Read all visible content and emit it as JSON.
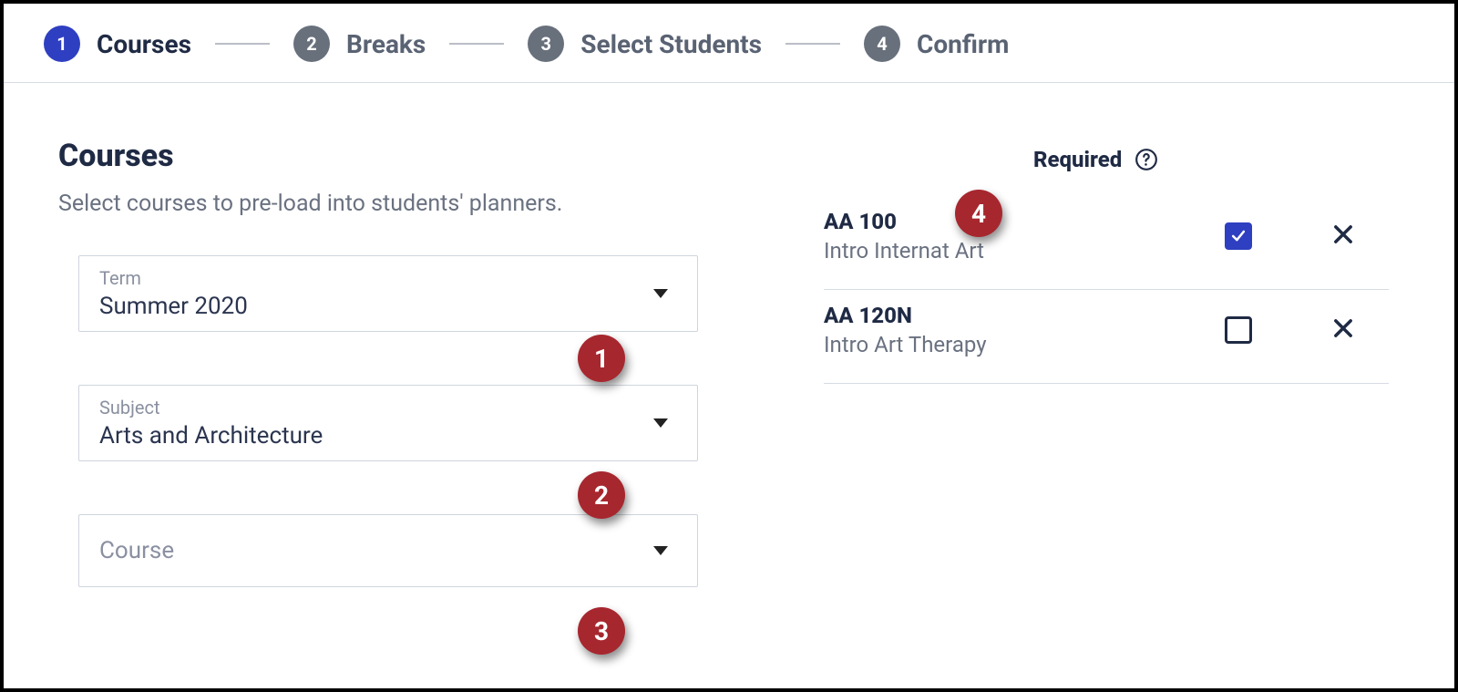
{
  "stepper": {
    "steps": [
      {
        "num": "1",
        "label": "Courses",
        "active": true
      },
      {
        "num": "2",
        "label": "Breaks",
        "active": false
      },
      {
        "num": "3",
        "label": "Select Students",
        "active": false
      },
      {
        "num": "4",
        "label": "Confirm",
        "active": false
      }
    ]
  },
  "section": {
    "title": "Courses",
    "subtitle": "Select courses to pre-load into students' planners."
  },
  "dropdowns": {
    "term": {
      "label": "Term",
      "value": "Summer 2020"
    },
    "subject": {
      "label": "Subject",
      "value": "Arts and Architecture"
    },
    "course": {
      "label": "Course",
      "value": ""
    }
  },
  "required_header": "Required",
  "courses": [
    {
      "code": "AA 100",
      "name": "Intro Internat Art",
      "required": true
    },
    {
      "code": "AA 120N",
      "name": "Intro Art Therapy",
      "required": false
    }
  ],
  "annotations": {
    "b1": "1",
    "b2": "2",
    "b3": "3",
    "b4": "4"
  }
}
